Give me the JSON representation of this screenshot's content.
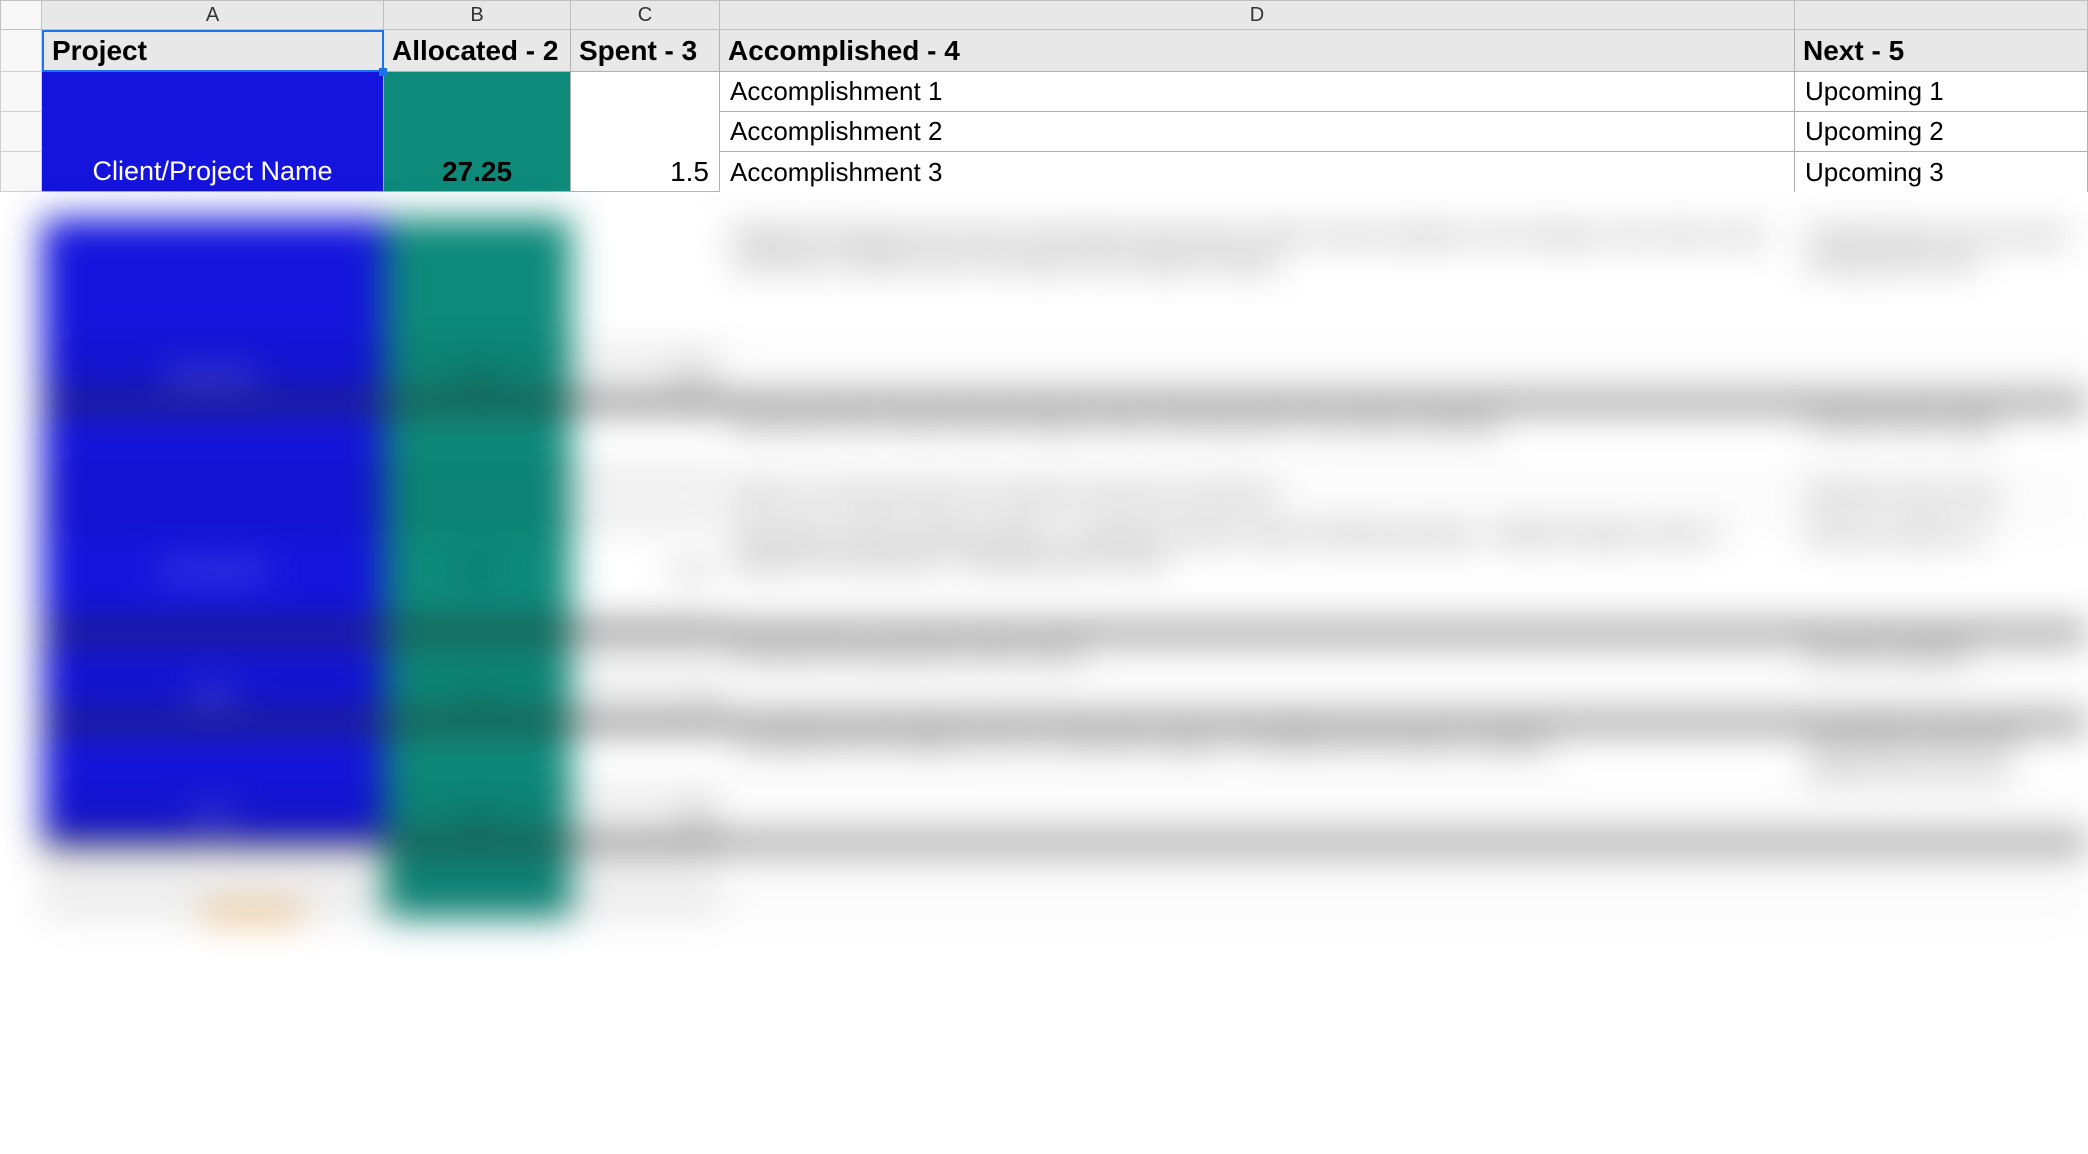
{
  "columns": {
    "a": "A",
    "b": "B",
    "c": "C",
    "d": "D",
    "e": ""
  },
  "headers": {
    "project": "Project",
    "allocated": "Allocated - 2",
    "spent": "Spent - 3",
    "accomplished": "Accomplished - 4",
    "next": "Next - 5"
  },
  "project": {
    "name": "Client/Project Name",
    "allocated": "27.25",
    "spent": "1.5"
  },
  "accomplishments": [
    "Accomplishment 1",
    "Accomplishment 2",
    "Accomplishment 3"
  ],
  "upcoming": [
    "Upcoming 1",
    "Upcoming 2",
    "Upcoming 3"
  ],
  "colors": {
    "project_bg": "#1414dc",
    "allocated_bg": "#0d8a7a",
    "header_bg": "#e8e8e8",
    "selection": "#1a73e8"
  }
}
